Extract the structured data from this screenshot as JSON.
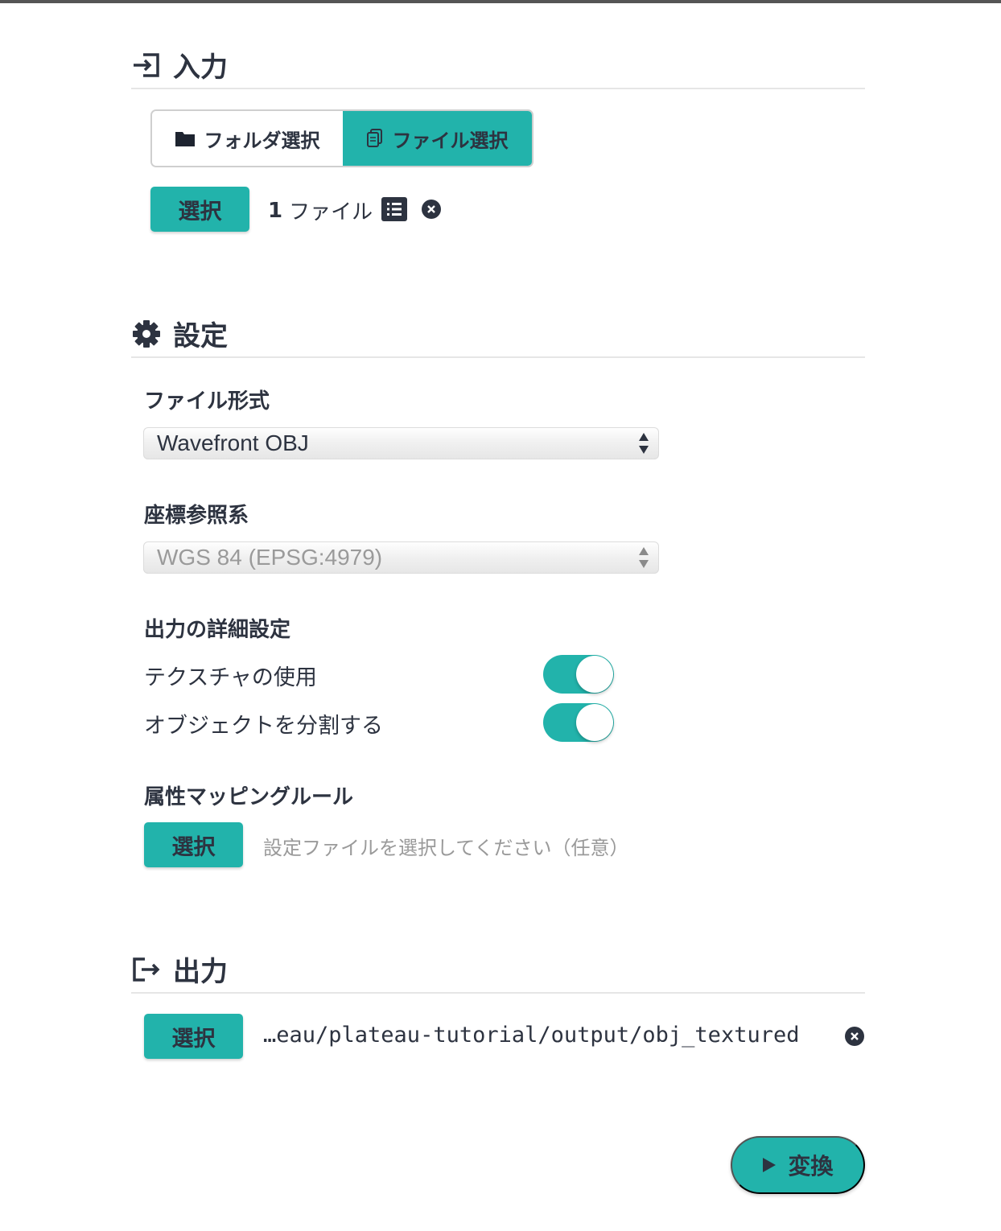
{
  "input": {
    "title": "入力",
    "icon": "sign-in-icon",
    "mode_folder_label": "フォルダ選択",
    "mode_file_label": "ファイル選択",
    "selected_mode": "file",
    "select_button": "選択",
    "file_count_number": "1",
    "file_count_unit": "ファイル"
  },
  "settings": {
    "title": "設定",
    "icon": "gear-icon",
    "file_format_label": "ファイル形式",
    "file_format_value": "Wavefront OBJ",
    "crs_label": "座標参照系",
    "crs_value": "WGS 84 (EPSG:4979)",
    "advanced_label": "出力の詳細設定",
    "toggles": [
      {
        "label": "テクスチャの使用",
        "on": true
      },
      {
        "label": "オブジェクトを分割する",
        "on": true
      }
    ],
    "mapping_label": "属性マッピングルール",
    "mapping_button": "選択",
    "mapping_placeholder": "設定ファイルを選択してください（任意）"
  },
  "output": {
    "title": "出力",
    "icon": "sign-out-icon",
    "select_button": "選択",
    "path": "…eau/plateau-tutorial/output/obj_textured"
  },
  "convert_button": "変換",
  "colors": {
    "accent": "#22b3ab",
    "text": "#2d3340",
    "muted": "#9a9a9a"
  }
}
